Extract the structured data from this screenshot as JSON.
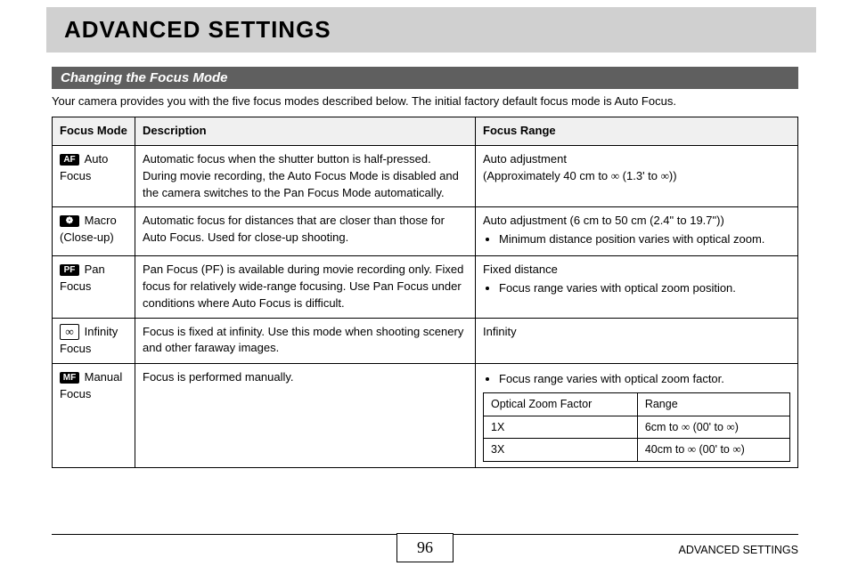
{
  "page": {
    "title": "ADVANCED SETTINGS",
    "section": "Changing the Focus Mode",
    "intro": "Your camera provides you with the five focus modes described below. The initial factory default focus mode is Auto Focus.",
    "footer_label": "ADVANCED SETTINGS",
    "page_number": "96"
  },
  "headers": {
    "mode": "Focus Mode",
    "desc": "Description",
    "range": "Focus Range"
  },
  "inf": "∞",
  "rows": {
    "r1": {
      "badge": "AF",
      "label": "Auto Focus",
      "desc": "Automatic focus when the shutter button is half-pressed. During movie recording, the Auto Focus Mode is disabled and the camera switches to the Pan Focus Mode automatically.",
      "range_l1": "Auto adjustment",
      "range_l2a": "(Approximately 40 cm to ",
      "range_l2b": " (1.3' to ",
      "range_l2c": "))"
    },
    "r2": {
      "badge": "❁",
      "label": "Macro (Close-up)",
      "desc": "Automatic focus for distances that are closer than those for Auto Focus. Used for close-up shooting.",
      "range_l1": "Auto adjustment (6 cm to 50 cm (2.4\" to 19.7\"))",
      "range_bullet": "Minimum distance position varies with optical zoom."
    },
    "r3": {
      "badge": "PF",
      "label": "Pan Focus",
      "desc": "Pan Focus (PF) is available during movie recording only. Fixed focus for relatively wide-range focusing. Use Pan Focus under conditions where Auto Focus is difficult.",
      "range_l1": "Fixed distance",
      "range_bullet": "Focus range varies with optical zoom position."
    },
    "r4": {
      "badge_text": "∞",
      "label": "Infinity Focus",
      "desc": "Focus is fixed at infinity. Use this mode when shooting scenery and other faraway images.",
      "range_l1": "Infinity"
    },
    "r5": {
      "badge": "MF",
      "label": "Manual Focus",
      "desc": "Focus is performed manually.",
      "range_bullet": "Focus range varies with optical zoom factor.",
      "inner_h1": "Optical Zoom Factor",
      "inner_h2": "Range",
      "inner_r1c1": "1X",
      "inner_r1c2a": "6cm to ",
      "inner_r1c2b": " (00' to ",
      "inner_r1c2c": ")",
      "inner_r2c1": "3X",
      "inner_r2c2a": "40cm to ",
      "inner_r2c2b": " (00' to ",
      "inner_r2c2c": ")"
    }
  }
}
